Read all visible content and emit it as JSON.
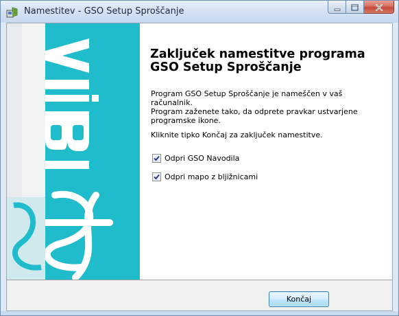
{
  "window": {
    "title": "Namestitev - GSO Setup Sproščanje",
    "controls": [
      "minimize",
      "maximize",
      "close"
    ]
  },
  "banner": {
    "logo_text": "BiA"
  },
  "main": {
    "heading_line1": "Zaključek namestitve programa",
    "heading_line2": "GSO Setup Sproščanje",
    "paragraph1_line1": "Program GSO Setup Sproščanje je nameščen v vaš računalnik.",
    "paragraph1_line2": "Program zaženete tako, da odprete pravkar ustvarjene",
    "paragraph1_line3": "programske ikone.",
    "paragraph2": "Kliknite tipko Končaj za zaključek namestitve.",
    "checkboxes": [
      {
        "label": "Odpri GSO Navodila",
        "checked": true
      },
      {
        "label": "Odpri mapo z bljižnicami",
        "checked": true
      }
    ]
  },
  "footer": {
    "finish_label": "Končaj"
  },
  "colors": {
    "banner_accent": "#1fb7c8",
    "button_border": "#3c7fb1",
    "close_button": "#c6483a"
  }
}
